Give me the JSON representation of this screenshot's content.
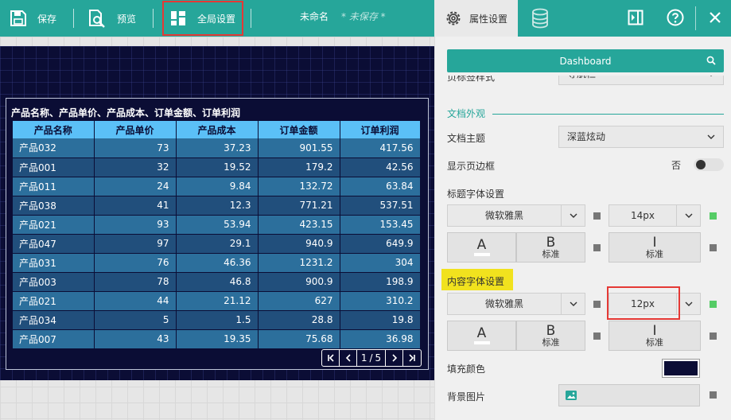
{
  "toolbar": {
    "save": "保存",
    "preview": "预览",
    "global_settings": "全局设置",
    "doc_name": "未命名",
    "doc_status": "* 未保存 *"
  },
  "panel_header": {
    "props_tab": "属性设置"
  },
  "widget": {
    "title": "产品名称、产品单价、产品成本、订单金额、订单利润",
    "columns": [
      "产品名称",
      "产品单价",
      "产品成本",
      "订单金额",
      "订单利润"
    ],
    "rows": [
      [
        "产品032",
        "73",
        "37.23",
        "901.55",
        "417.56"
      ],
      [
        "产品001",
        "32",
        "19.52",
        "179.2",
        "42.56"
      ],
      [
        "产品011",
        "24",
        "9.84",
        "132.72",
        "63.84"
      ],
      [
        "产品038",
        "41",
        "12.3",
        "771.21",
        "537.51"
      ],
      [
        "产品021",
        "93",
        "53.94",
        "423.15",
        "153.45"
      ],
      [
        "产品047",
        "97",
        "29.1",
        "940.9",
        "649.9"
      ],
      [
        "产品031",
        "76",
        "46.36",
        "1231.2",
        "304"
      ],
      [
        "产品003",
        "78",
        "46.8",
        "900.9",
        "198.9"
      ],
      [
        "产品021",
        "44",
        "21.12",
        "627",
        "310.2"
      ],
      [
        "产品034",
        "5",
        "1.5",
        "28.8",
        "19.8"
      ],
      [
        "产品007",
        "43",
        "19.35",
        "75.68",
        "36.98"
      ]
    ],
    "pager": {
      "current": "1",
      "separator": "/",
      "total": "5"
    }
  },
  "props": {
    "dashboard_button": "Dashboard",
    "cut_label": "页标签样式",
    "cut_value": "导航栏",
    "section_doc_appearance": "文档外观",
    "doc_theme_label": "文档主题",
    "doc_theme_value": "深蓝炫动",
    "show_border_label": "显示页边框",
    "show_border_value": "否",
    "title_font_label": "标题字体设置",
    "title_font_family": "微软雅黑",
    "title_font_size": "14px",
    "content_font_label": "内容字体设置",
    "content_font_family": "微软雅黑",
    "content_font_size": "12px",
    "color_btn_glyph": "A",
    "bold_btn_glyph": "B",
    "bold_btn_label": "标准",
    "italic_btn_glyph": "I",
    "italic_btn_label": "标准",
    "fill_color_label": "填充颜色",
    "fill_color_value": "#0b0d35",
    "bg_image_label": "背景图片"
  },
  "colors": {
    "accent": "#26a69a",
    "table_header": "#5bc0f7",
    "canvas_bg": "#0b0d35",
    "highlight": "#f1e21e",
    "annotation_red": "#e53935"
  }
}
